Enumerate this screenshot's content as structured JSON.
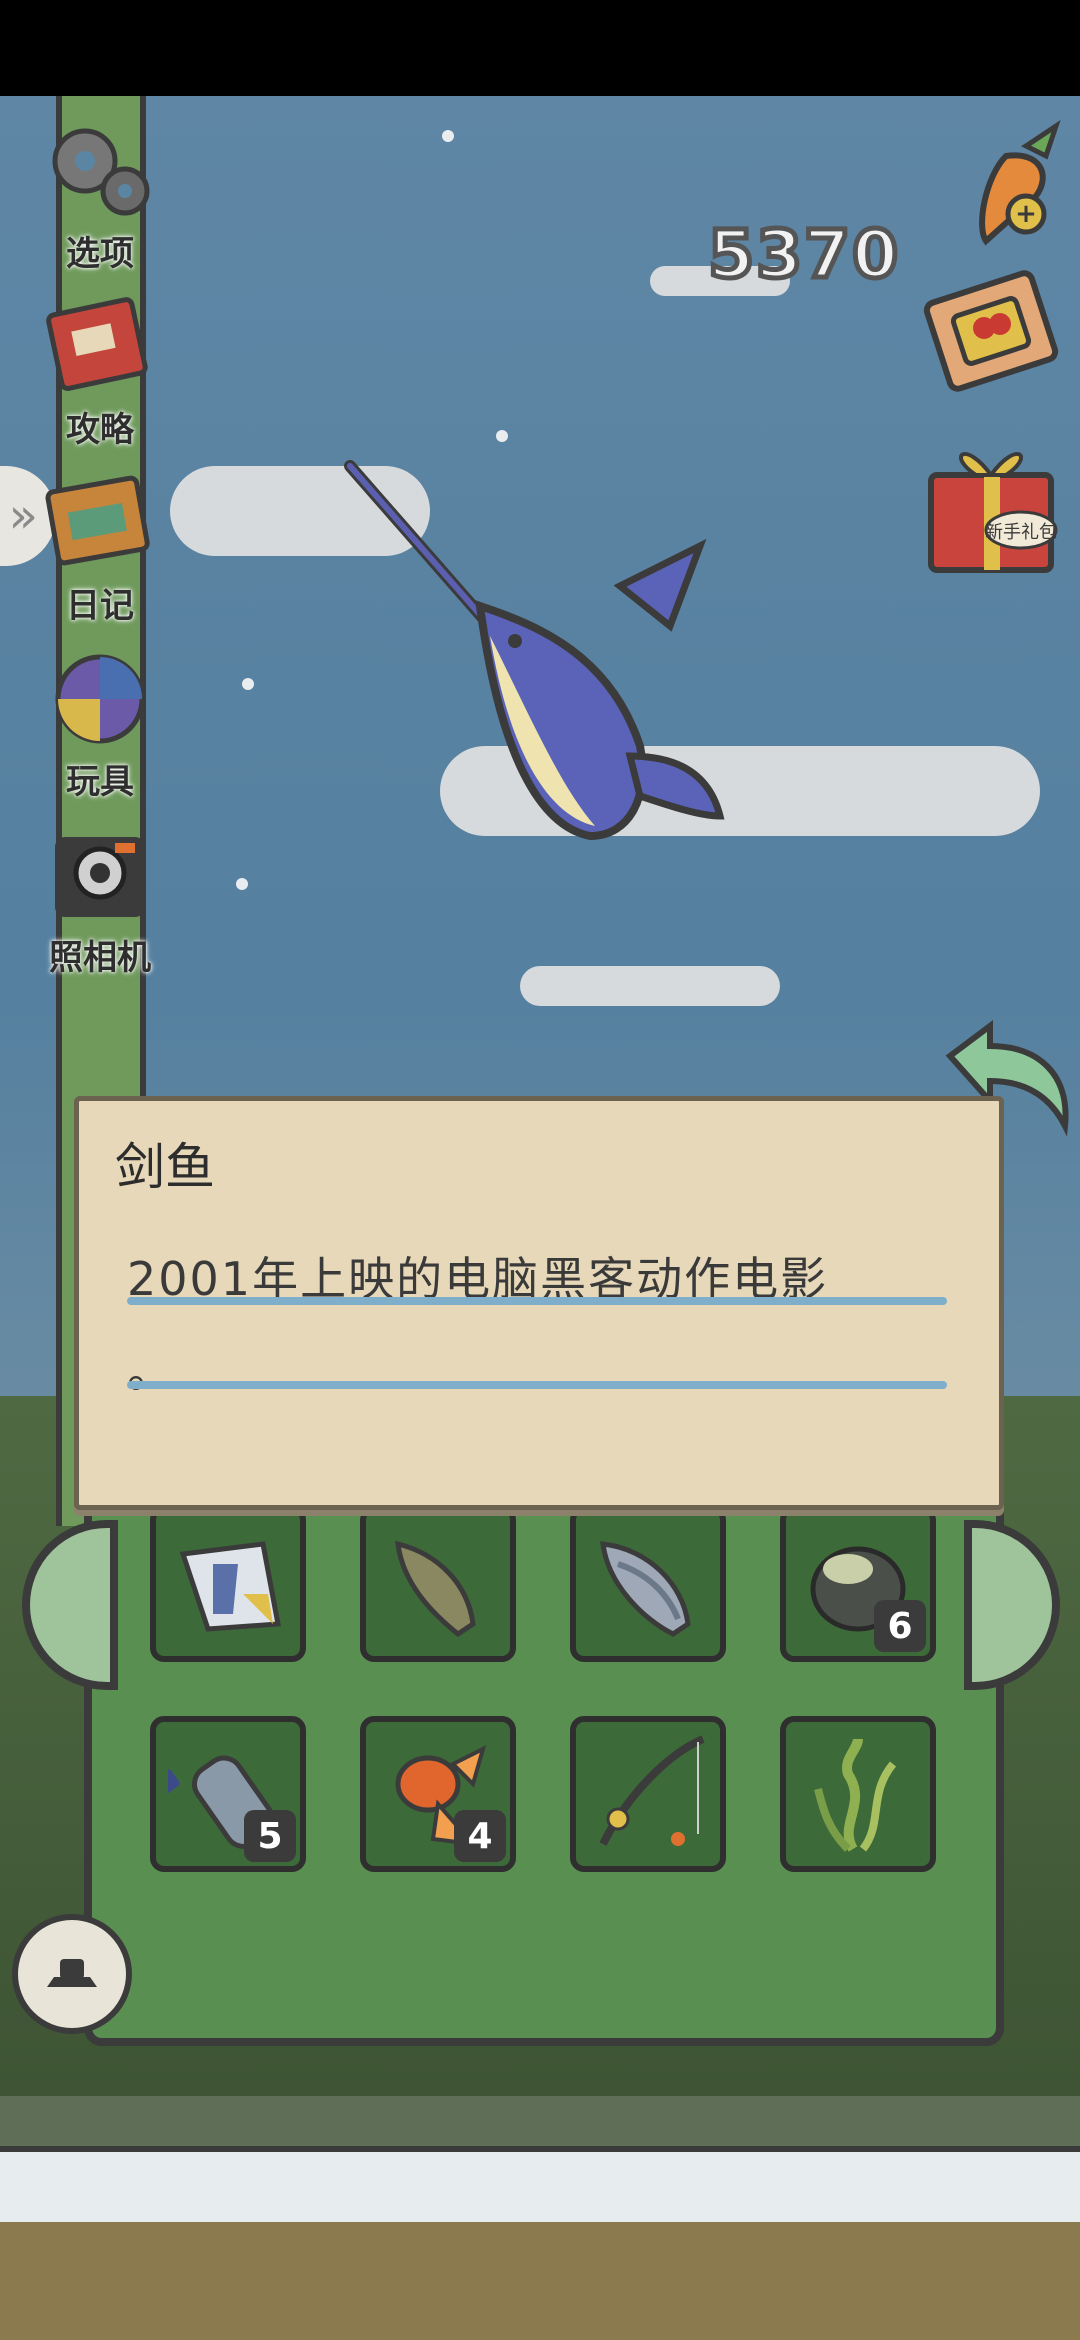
{
  "hud": {
    "carrot_count": "5370"
  },
  "sidebar": {
    "items": [
      {
        "label": "选项",
        "icon": "gear-icon"
      },
      {
        "label": "攻略",
        "icon": "guide-book-icon"
      },
      {
        "label": "日记",
        "icon": "diary-icon"
      },
      {
        "label": "玩具",
        "icon": "toy-icon"
      },
      {
        "label": "照相机",
        "icon": "camera-icon"
      }
    ]
  },
  "right_buttons": [
    {
      "name": "add-carrot-button",
      "icon": "carrot-plus-icon"
    },
    {
      "name": "ticket-button",
      "icon": "ticket-icon"
    },
    {
      "name": "starter-gift-button",
      "icon": "gift-box-icon",
      "label": "新手礼包"
    }
  ],
  "description_card": {
    "title": "剑鱼",
    "text_line1": "2001年上映的电脑黑客动作电影",
    "text_line2": "。"
  },
  "inventory": {
    "slots": [
      {
        "item": "triggerfish",
        "count": ""
      },
      {
        "item": "brown-trout",
        "count": ""
      },
      {
        "item": "salmon",
        "count": ""
      },
      {
        "item": "monkfish",
        "count": "6"
      },
      {
        "item": "plastic-bottle",
        "count": "5"
      },
      {
        "item": "goldfish",
        "count": "4"
      },
      {
        "item": "fishing-rod",
        "count": ""
      },
      {
        "item": "seaweed",
        "count": ""
      }
    ]
  },
  "colors": {
    "panel_green": "#5a8f52",
    "card_bg": "#e6d8b8",
    "rule_blue": "#7eaec9"
  }
}
